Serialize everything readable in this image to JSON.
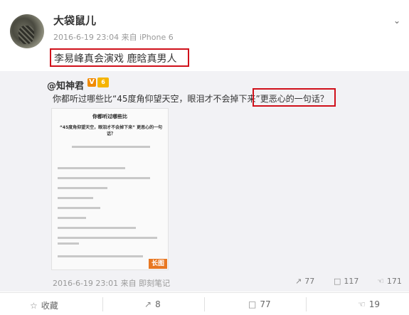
{
  "post": {
    "username": "大袋鼠儿",
    "meta": "2016-6-19 23:04 来自 iPhone 6",
    "text": "李易峰真会演戏 鹿晗真男人"
  },
  "repost": {
    "username": "@知神君",
    "v_badge": "V",
    "text": "你都听过哪些比“45度角仰望天空，眼泪才不会掉下来”更恶心的一句话？",
    "meta": "2016-6-19 23:01 来自 即刻笔记",
    "forwards": "77",
    "comments": "117",
    "likes": "171",
    "image": {
      "title": "你都听过哪些比",
      "question": "“45度角仰望天空，眼泪才不会掉下来” 更恶心的一句话？",
      "long_tag": "长图"
    }
  },
  "actions": {
    "favorite": "收藏",
    "forward": "8",
    "comment": "77",
    "like": "19"
  }
}
